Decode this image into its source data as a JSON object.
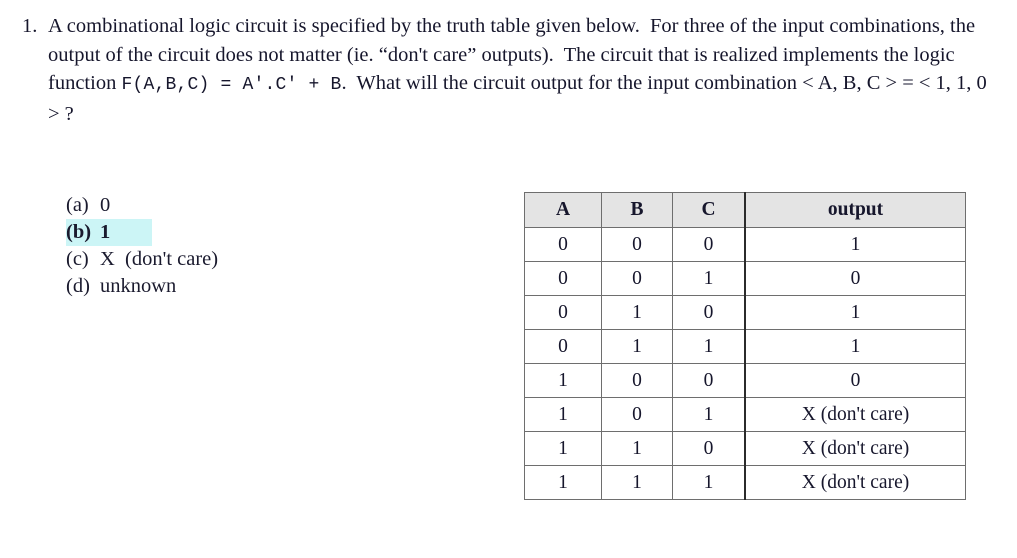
{
  "question": {
    "number": "1.",
    "text_part1": "A combinational logic circuit is specified by the truth table given below.",
    "text_part2": "For three of the input combinations, the output of the circuit does not matter (ie. “don't care” outputs).",
    "text_part3": "The circuit that is realized implements the logic function",
    "function_expression": "F(A,B,C)  =  A'.C'  +  B",
    "text_part4": ".",
    "text_part5": "What will the circuit output for the input combination",
    "input_combination": "< A, B, C >  =  < 1, 1, 0 > ?"
  },
  "answers": {
    "selected_key": "b",
    "highlight_color": "#ccf5f6",
    "options": [
      {
        "key": "(a)",
        "text": "0",
        "selected": false
      },
      {
        "key": "(b)",
        "text": "1",
        "selected": true
      },
      {
        "key": "(c)",
        "text": "X  (don't care)",
        "selected": false
      },
      {
        "key": "(d)",
        "text": "unknown",
        "selected": false
      }
    ]
  },
  "truth_table": {
    "headers": [
      "A",
      "B",
      "C",
      "output"
    ],
    "header_bg": "#e4e4e4",
    "rows": [
      [
        "0",
        "0",
        "0",
        "1"
      ],
      [
        "0",
        "0",
        "1",
        "0"
      ],
      [
        "0",
        "1",
        "0",
        "1"
      ],
      [
        "0",
        "1",
        "1",
        "1"
      ],
      [
        "1",
        "0",
        "0",
        "0"
      ],
      [
        "1",
        "0",
        "1",
        "X (don't care)"
      ],
      [
        "1",
        "1",
        "0",
        "X (don't care)"
      ],
      [
        "1",
        "1",
        "1",
        "X (don't care)"
      ]
    ]
  }
}
